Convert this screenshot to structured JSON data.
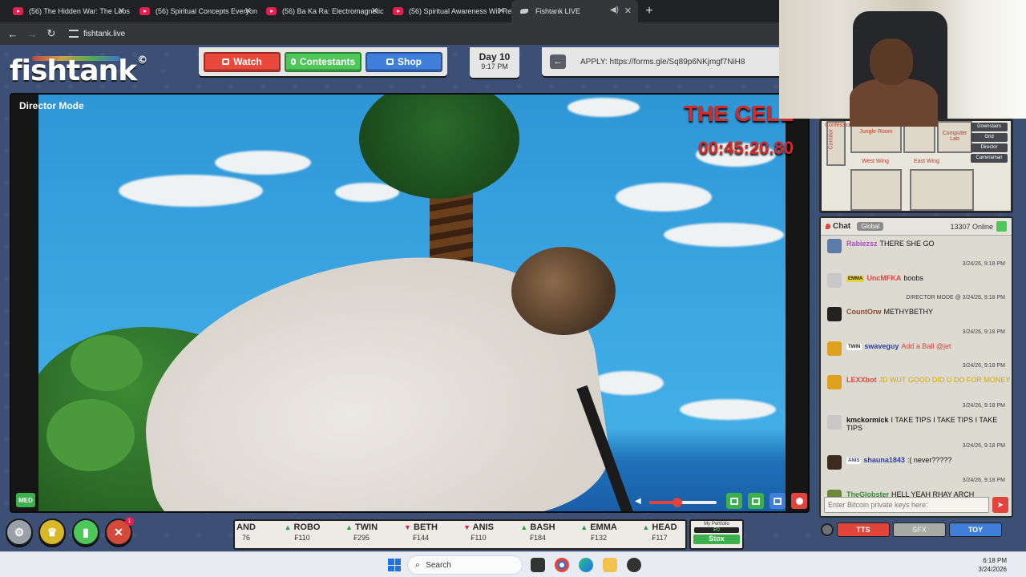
{
  "browser": {
    "tabs": [
      {
        "title": "(56) The Hidden War: The Loos",
        "active": false
      },
      {
        "title": "(56) Spiritual Concepts Everyon",
        "active": false
      },
      {
        "title": "(56) Ba Ka Ra: Electromagnetic",
        "active": false
      },
      {
        "title": "(56) Spiritual Awareness Will Re",
        "active": false
      },
      {
        "title": "Fishtank LIVE",
        "active": true
      }
    ],
    "new_tab": "+",
    "url": "fishtank.live"
  },
  "site": {
    "logo": "fishtank",
    "logo_mark": "©",
    "nav": {
      "watch": "Watch",
      "contestants": "Contestants",
      "shop": "Shop"
    },
    "day": "Day 10",
    "time": "9:17 PM",
    "apply": "APPLY: https://forms.gle/Sq89p6NKjmgf7NiH8"
  },
  "player": {
    "mode": "Director Mode",
    "room": "THE CELL",
    "timer": "00:45:20.80",
    "quality": "MED",
    "volume": 0.42
  },
  "controls": {
    "badge_count": "1"
  },
  "ticker": [
    {
      "name": "AND",
      "price": "76",
      "dir": "none"
    },
    {
      "name": "ROBO",
      "price": "₣110",
      "dir": "up"
    },
    {
      "name": "TWIN",
      "price": "₣295",
      "dir": "up"
    },
    {
      "name": "BETH",
      "price": "₣144",
      "dir": "down"
    },
    {
      "name": "ANIS",
      "price": "₣110",
      "dir": "down"
    },
    {
      "name": "BASH",
      "price": "₣184",
      "dir": "up"
    },
    {
      "name": "EMMA",
      "price": "₣132",
      "dir": "up"
    },
    {
      "name": "HEAD",
      "price": "₣117",
      "dir": "up"
    }
  ],
  "portfolio": {
    "label": "My Portfolio",
    "value": "₣0",
    "button": "Stox"
  },
  "map": {
    "rooms": {
      "confession": "Confession",
      "jungle": "Jungle Room",
      "computer_lab": "Computer Lab",
      "corridor": "Corridor",
      "west_wing": "West Wing",
      "east_wing": "East Wing"
    },
    "tabs": [
      "Downstairs",
      "Grid",
      "Director",
      "Cameraman"
    ]
  },
  "chat": {
    "title": "Chat",
    "scope": "Global",
    "online": "13307 Online",
    "placeholder": "Enter Bitcoin private keys here:",
    "messages": [
      {
        "user": "Rabiezsz",
        "text": "THERE SHE GO",
        "time": "3/24/26, 9:18 PM",
        "user_color": "#b04ac4",
        "tag": "",
        "avatar": "#5d7da8"
      },
      {
        "user": "UncMFKA",
        "text": "boobs",
        "time": "DIRECTOR MODE @ 3/24/26, 9:18 PM",
        "user_color": "#e0443a",
        "tag": "EMMA",
        "avatar": "#c7c7c7"
      },
      {
        "user": "CountOrw",
        "text": "METHYBETHY",
        "time": "3/24/26, 9:18 PM",
        "user_color": "#8a4a2a",
        "tag": "",
        "avatar": "#222222"
      },
      {
        "user": "swaveguy",
        "text": "Add a Ball @jet",
        "time": "3/24/26, 9:18 PM",
        "user_color": "#2a3fa8",
        "tag": "TWIN",
        "avatar": "#e0a020",
        "text_color": "#e0443a"
      },
      {
        "user": "LEXXbot",
        "text": "JD WUT GOOD DID U DO FOR MONEY",
        "time": "3/24/26, 9:18 PM",
        "user_color": "#e0443a",
        "tag": "",
        "avatar": "#e0a020",
        "text_color": "#d4a800"
      },
      {
        "user": "kmckormick",
        "text": "I TAKE TIPS I TAKE TIPS I TAKE TIPS",
        "time": "3/24/26, 9:18 PM",
        "user_color": "#111111",
        "tag": "",
        "avatar": "#c7c7c7"
      },
      {
        "user": "shauna1843",
        "text": ":( never?????",
        "time": "3/24/26, 9:18 PM",
        "user_color": "#2a3fa8",
        "tag": "ANIS",
        "avatar": "#3a2a20"
      },
      {
        "user": "TheGlobster",
        "text": "HELL YEAH RHAY ARCH",
        "time": "",
        "user_color": "#3a8a3a",
        "tag": "",
        "avatar": "#6a8a3a"
      }
    ],
    "buttons": {
      "tts": "TTS",
      "sfx": "SFX",
      "toy": "TOY"
    }
  },
  "taskbar": {
    "search": "Search",
    "time": "6:18 PM",
    "date": "3/24/2026"
  },
  "colors": {
    "accent_red": "#e0443a",
    "accent_green": "#4cc758",
    "accent_blue": "#3f7fda",
    "page_bg": "#3c5076"
  }
}
